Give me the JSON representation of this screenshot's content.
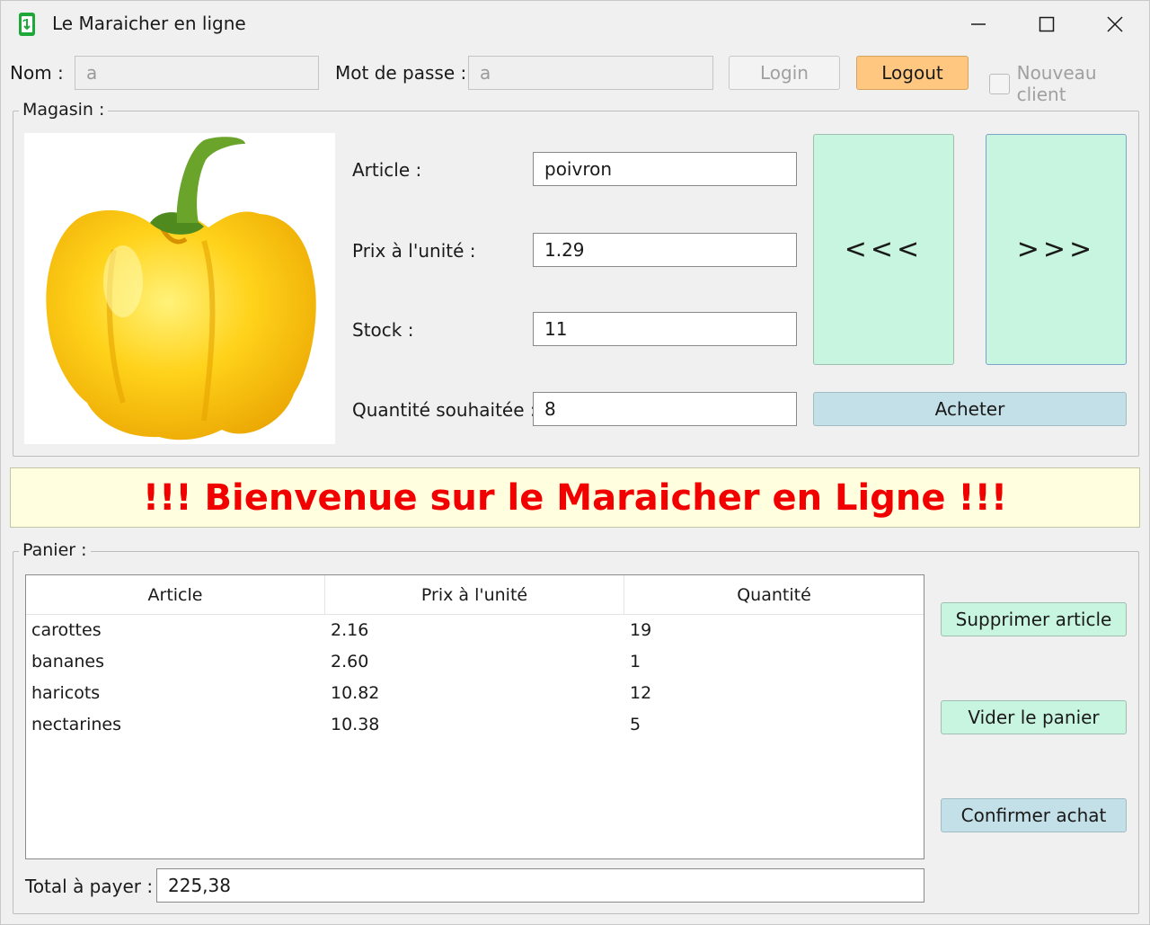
{
  "window": {
    "title": "Le Maraicher en ligne",
    "controls": {
      "minimize": "minimize-icon",
      "maximize": "maximize-icon",
      "close": "close-icon"
    }
  },
  "login": {
    "nom_label": "Nom :",
    "nom_value": "a",
    "password_label": "Mot de passe :",
    "password_value": "a",
    "login_button": "Login",
    "logout_button": "Logout",
    "new_client_label": "Nouveau client",
    "new_client_checked": false
  },
  "magasin": {
    "title": "Magasin :",
    "article_label": "Article :",
    "article_value": "poivron",
    "prix_label": "Prix à l'unité :",
    "prix_value": "1.29",
    "stock_label": "Stock :",
    "stock_value": "11",
    "quantite_label": "Quantité souhaitée :",
    "quantite_value": "8",
    "prev_button": "<<<",
    "next_button": ">>>",
    "acheter_button": "Acheter",
    "image": "yellow-bell-pepper"
  },
  "banner": {
    "text": "!!! Bienvenue sur le Maraicher en Ligne !!!",
    "color": "#f20000",
    "background": "#ffffe0"
  },
  "panier": {
    "title": "Panier :",
    "columns": [
      "Article",
      "Prix à l'unité",
      "Quantité"
    ],
    "rows": [
      [
        "carottes",
        "2.16",
        "19"
      ],
      [
        "bananes",
        "2.60",
        "1"
      ],
      [
        "haricots",
        "10.82",
        "12"
      ],
      [
        "nectarines",
        "10.38",
        "5"
      ]
    ],
    "supprimer_button": "Supprimer article",
    "vider_button": "Vider le panier",
    "confirmer_button": "Confirmer achat",
    "total_label": "Total à payer :",
    "total_value": "225,38"
  },
  "colors": {
    "logout": "#ffc780",
    "nav_buttons": "#c8f5df",
    "acheter": "#c3dfe7",
    "app_icon": "#1fa83a"
  }
}
